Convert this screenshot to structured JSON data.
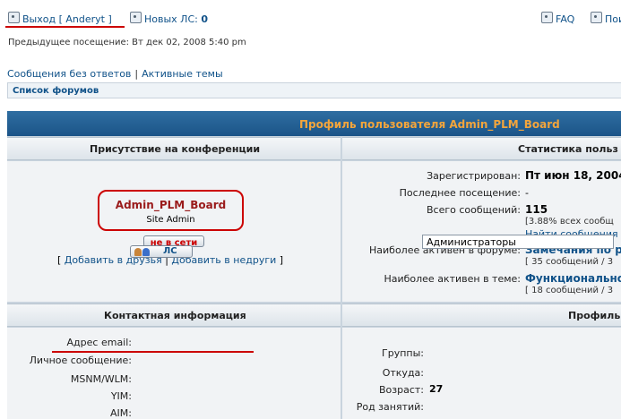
{
  "header": {
    "logout_label": "Выход [ Anderyt ]",
    "pm_label": "Новых ЛС:",
    "pm_count": "0",
    "faq_label": "FAQ",
    "search_label": "Пои",
    "last_visit": "Предыдущее посещение: Вт дек 02, 2008 5:40 pm"
  },
  "quicklinks": {
    "unanswered": "Сообщения без ответов",
    "separator": "|",
    "active": "Активные темы"
  },
  "breadcrumb": {
    "forum_index": "Список форумов"
  },
  "profile": {
    "title": "Профиль пользователя Admin_PLM_Board",
    "presence_header": "Присутствие на конференции",
    "stats_header": "Статистика польз",
    "username": "Admin_PLM_Board",
    "rank": "Site Admin",
    "status": "не в сети",
    "add_friend_open": "[",
    "add_friend": "Добавить в друзья",
    "friend_sep": "|",
    "add_foe": "Добавить в недруги",
    "add_foe_close": "]",
    "stats": {
      "registered_label": "Зарегистрирован:",
      "registered_value": "Пт июн 18, 2004",
      "last_visit_label": "Последнее посещение:",
      "last_visit_value": "-",
      "posts_label": "Всего сообщений:",
      "posts_value": "115",
      "posts_pct": "[3.88% всех сообщ",
      "find_posts": "Найти сообщения",
      "active_forum_label": "Наиболее активен в форуме:",
      "active_forum_value": "Замечания по ра",
      "active_forum_count": "[ 35 сообщений / 3",
      "active_topic_label": "Наиболее активен в теме:",
      "active_topic_value": "Функциональнос",
      "active_topic_count": "[ 18 сообщений / 3"
    },
    "contact_header": "Контактная информация",
    "profile_header": "Профиль",
    "contact": {
      "email_label": "Адрес email:",
      "pm_label": "Личное сообщение:",
      "pm_button": "ЛС",
      "msnm_label": "MSNM/WLM:",
      "yim_label": "YIM:",
      "aim_label": "AIM:"
    },
    "profile_info": {
      "groups_label": "Группы:",
      "groups_value": "Администраторы",
      "from_label": "Откуда:",
      "age_label": "Возраст:",
      "age_value": "27",
      "occupation_label": "Род занятий:"
    }
  },
  "colors": {
    "accent": "#105289",
    "title_text": "#f3a53c",
    "highlight": "#cc0000"
  }
}
